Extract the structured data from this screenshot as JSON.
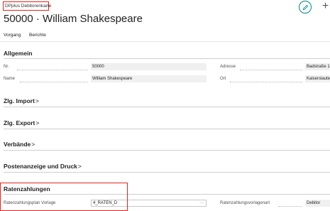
{
  "header": {
    "page_caption": "DPplus Debitorenkarte",
    "record_title": "50000 · William Shakespeare",
    "edit_icon": "pencil-icon",
    "add_icon": "plus-icon",
    "add_glyph": "+"
  },
  "actions": [
    "Vorgang",
    "Berichte"
  ],
  "sections": {
    "allgemein": "Allgemein",
    "zlg_import": "Zlg. Import",
    "zlg_export": "Zlg. Export",
    "verbaende": "Verbände",
    "postenanzeige": "Postenanzeige und Druck",
    "ratenzahlungen": "Ratenzahlungen",
    "chevron": ">"
  },
  "fields": {
    "nr_label": "Nr.",
    "nr_value": "50000",
    "name_label": "Name",
    "name_value": "William Shakespeare",
    "adresse_label": "Adresse",
    "adresse_value": "Badstraße 1",
    "ort_label": "Ort",
    "ort_value": "Kaiserslaute",
    "plan_label": "Ratenzahlungsplan Vorlage",
    "plan_value": "4_RATEN_D",
    "plan_lookup": "···",
    "vorlagenart_label": "Ratenzahlungsvorlagenart",
    "vorlagenart_value": "Debitor"
  },
  "colors": {
    "accent": "#008489",
    "highlight": "#e1251b"
  }
}
